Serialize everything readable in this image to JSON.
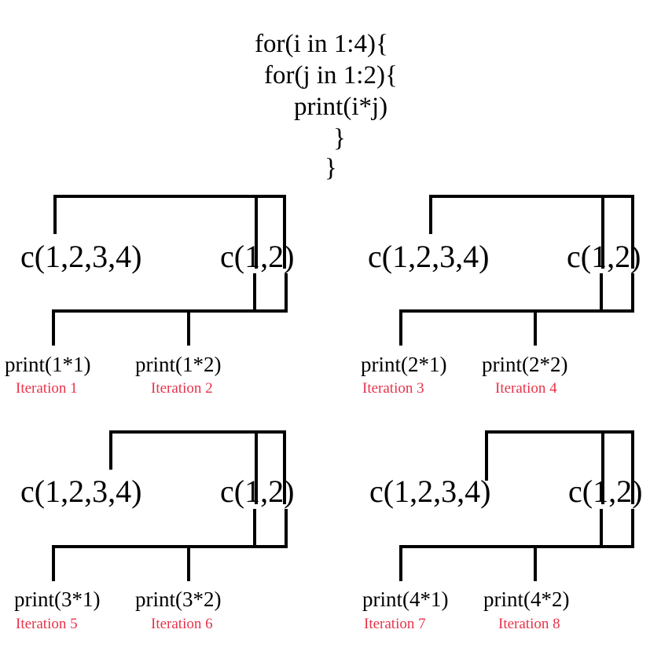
{
  "code": {
    "lines": [
      "for(i in 1:4){",
      "for(j in 1:2){",
      "print(i*j)",
      "}",
      "}"
    ]
  },
  "panels": [
    {
      "outer_vector": "c(1,2,3,4)",
      "inner_vector": "c(1,2)",
      "calls": [
        {
          "text": "print(1*1)",
          "iteration": "Iteration 1"
        },
        {
          "text": "print(1*2)",
          "iteration": "Iteration 2"
        }
      ]
    },
    {
      "outer_vector": "c(1,2,3,4)",
      "inner_vector": "c(1,2)",
      "calls": [
        {
          "text": "print(2*1)",
          "iteration": "Iteration 3"
        },
        {
          "text": "print(2*2)",
          "iteration": "Iteration 4"
        }
      ]
    },
    {
      "outer_vector": "c(1,2,3,4)",
      "inner_vector": "c(1,2)",
      "calls": [
        {
          "text": "print(3*1)",
          "iteration": "Iteration 5"
        },
        {
          "text": "print(3*2)",
          "iteration": "Iteration 6"
        }
      ]
    },
    {
      "outer_vector": "c(1,2,3,4)",
      "inner_vector": "c(1,2)",
      "calls": [
        {
          "text": "print(4*1)",
          "iteration": "Iteration 7"
        },
        {
          "text": "print(4*2)",
          "iteration": "Iteration 8"
        }
      ]
    }
  ],
  "colors": {
    "iteration_label": "#e8334a",
    "lines": "#000000"
  }
}
